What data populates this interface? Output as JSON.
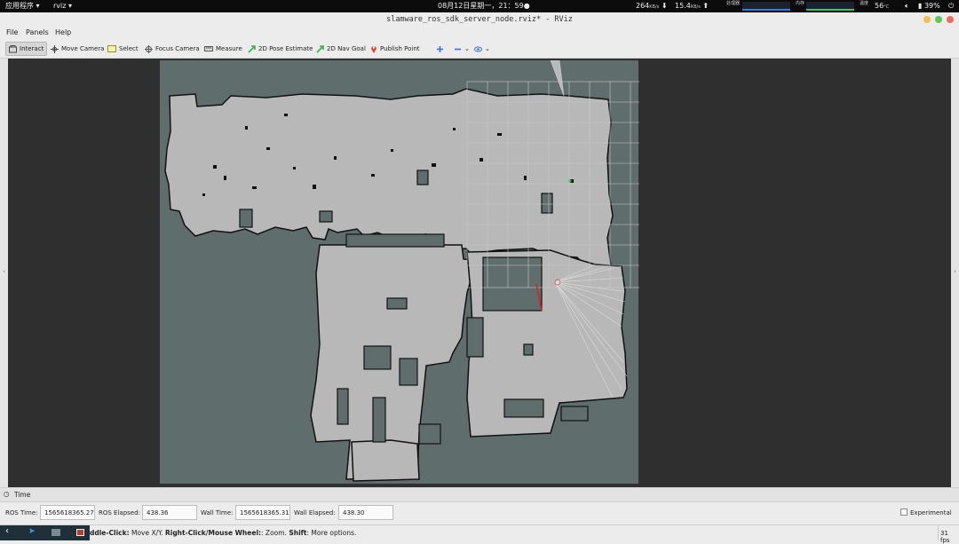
{
  "topbar": {
    "apps_label": "应用程序 ▾",
    "app_name": "rviz ▾",
    "datetime": "08月12日星期一，21：59●",
    "net_down": "264",
    "net_down_unit": "KB/s",
    "net_up": "15.4",
    "net_up_unit": "KB/s",
    "cpu_caption": "处理器",
    "mem_caption": "内存",
    "temp_caption": "温度",
    "temp": "56",
    "temp_unit": "°C",
    "volume_icon": "volume-icon",
    "battery": "39%",
    "power_icon": "power-icon"
  },
  "window": {
    "title": "slamware_ros_sdk_server_node.rviz* - RViz"
  },
  "menu": {
    "file": "File",
    "panels": "Panels",
    "help": "Help"
  },
  "toolbar": {
    "interact": "Interact",
    "move_camera": "Move Camera",
    "select": "Select",
    "focus_camera": "Focus Camera",
    "measure": "Measure",
    "pose_estimate": "2D Pose Estimate",
    "nav_goal": "2D Nav Goal",
    "publish_point": "Publish Point"
  },
  "time_panel": {
    "header": "Time",
    "ros_time_label": "ROS Time:",
    "ros_time": "1565618365.27",
    "ros_elapsed_label": "ROS Elapsed:",
    "ros_elapsed": "438.36",
    "wall_time_label": "Wall Time:",
    "wall_time": "1565618365.31",
    "wall_elapsed_label": "Wall Elapsed:",
    "wall_elapsed": "438.30",
    "experimental_label": "Experimental"
  },
  "status": {
    "mid_label": "ddle-Click:",
    "mid_text": " Move X/Y. ",
    "right_label": "Right-Click/Mouse Wheel:",
    "right_text": ": Zoom. ",
    "shift_label": "Shift",
    "shift_text": ": More options.",
    "fps": "31 fps"
  }
}
